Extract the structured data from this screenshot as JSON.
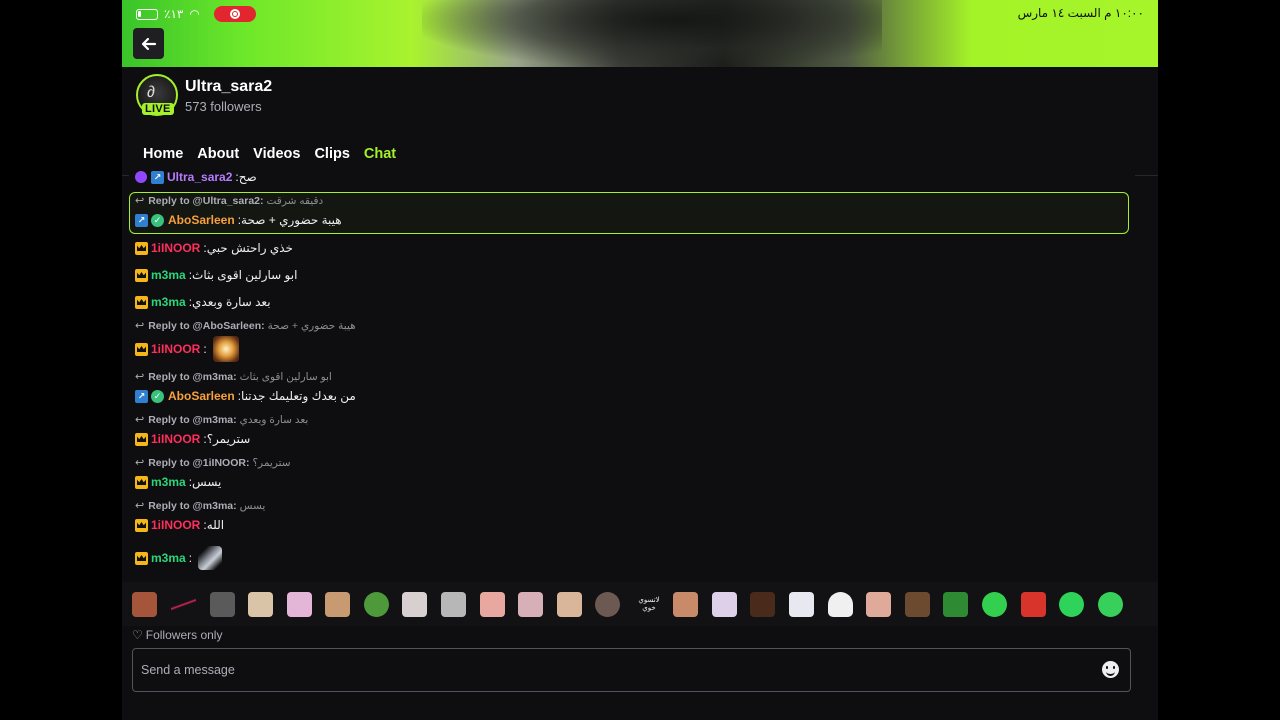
{
  "status_bar": {
    "battery": "٪١٣",
    "datetime": "١٠:٠٠ م  السبت ١٤ مارس"
  },
  "channel": {
    "name": "Ultra_sara2",
    "followers": "573 followers",
    "live_label": "LIVE"
  },
  "tabs": [
    {
      "label": "Home"
    },
    {
      "label": "About"
    },
    {
      "label": "Videos"
    },
    {
      "label": "Clips"
    },
    {
      "label": "Chat"
    }
  ],
  "chat": {
    "messages": [
      {
        "user": "Ultra_sara2",
        "text": ":صح"
      },
      {
        "reply_to": "Reply to @Ultra_sara2:",
        "reply_quote": "دقيقه شرقت"
      },
      {
        "user": "AboSarleen",
        "text": ":هيبة حضوري + صحة"
      },
      {
        "user": "1iINOOR",
        "text": ":خذي راحتش حبي"
      },
      {
        "user": "m3ma",
        "text": ":ابو سارلين اقوى بثاث"
      },
      {
        "user": "m3ma",
        "text": ":بعد سارة وبعدي"
      },
      {
        "reply_to": "Reply to @AboSarleen:",
        "reply_quote": "هيبة حضوري + صحة"
      },
      {
        "user": "1iINOOR",
        "text": ":"
      },
      {
        "reply_to": "Reply to @m3ma:",
        "reply_quote": "ابو سارلين اقوى بثاث"
      },
      {
        "user": "AboSarleen",
        "text": ":من بعدك وتعليمك جدتنا"
      },
      {
        "reply_to": "Reply to @m3ma:",
        "reply_quote": "بعد سارة وبعدي"
      },
      {
        "user": "1iINOOR",
        "text": ":ستريمر؟"
      },
      {
        "reply_to": "Reply to @1iINOOR:",
        "reply_quote": "ستريمر؟"
      },
      {
        "user": "m3ma",
        "text": ":يسس"
      },
      {
        "reply_to": "Reply to @m3ma:",
        "reply_quote": "يسس"
      },
      {
        "user": "1iINOOR",
        "text": ":الله"
      },
      {
        "user": "m3ma",
        "text": ":"
      }
    ]
  },
  "emote_bar": {
    "text_emote": "لاتسوي خوي"
  },
  "composer": {
    "followers_only": "Followers only",
    "placeholder": "Send a message"
  },
  "colors": {
    "accent": "#a3f02b",
    "user_1iinoor": "#ff2f5b",
    "user_m3ma": "#2bd57b",
    "user_abosarleen": "#f7a03c",
    "user_ultra": "#b67cff"
  }
}
